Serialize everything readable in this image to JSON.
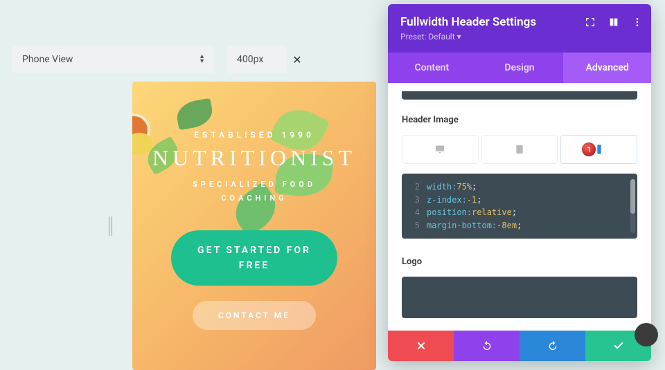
{
  "toolbar": {
    "view_select": "Phone View",
    "width_value": "400px"
  },
  "preview": {
    "established": "ESTABLISED 1990",
    "brand": "NUTRITIONIST",
    "subtitle_l1": "SPECIALIZED FOOD",
    "subtitle_l2": "COACHING",
    "cta_primary": "GET STARTED FOR FREE",
    "cta_secondary": "CONTACT ME"
  },
  "panel": {
    "title": "Fullwidth Header Settings",
    "preset": "Preset: Default ▾",
    "tabs": {
      "content": "Content",
      "design": "Design",
      "advanced": "Advanced"
    },
    "section_header_image": "Header Image",
    "device_badge": "1",
    "code": {
      "l2_n": "2",
      "l2_prop": "width:",
      "l2_val": "75%",
      "l3_n": "3",
      "l3_prop": "z-index:",
      "l3_val": "-1",
      "l4_n": "4",
      "l4_prop": "position:",
      "l4_val": "relative",
      "l5_n": "5",
      "l5_prop": "margin-bottom:",
      "l5_val": "-8em",
      "semi": ";"
    },
    "section_logo": "Logo"
  }
}
